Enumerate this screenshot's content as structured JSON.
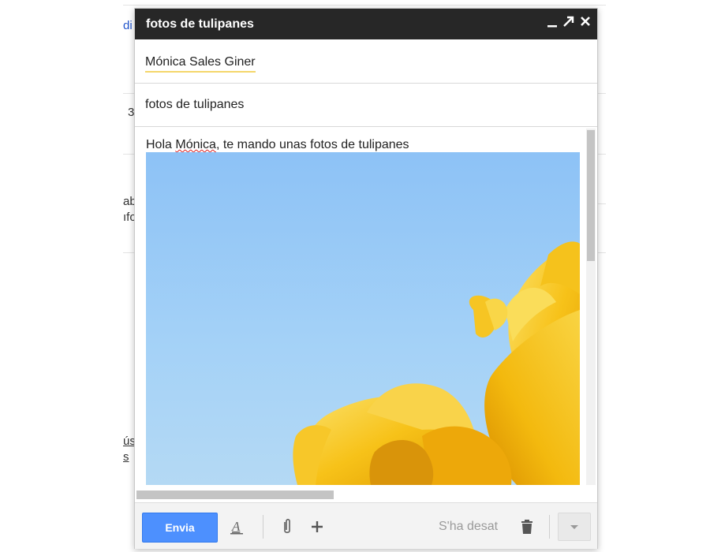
{
  "compose": {
    "title": "fotos de tulipanes",
    "to": "Mónica Sales Giner",
    "subject": "fotos de tulipanes",
    "body_greeting": "Hola ",
    "body_name": "Mónica",
    "body_rest": ", te mando unas fotos de tulipanes",
    "image_alt": "foto de tulipanes"
  },
  "toolbar": {
    "send_label": "Envia",
    "saved_status": "S'ha desat"
  },
  "background": {
    "fragment_1": "di",
    "fragment_2": "3",
    "fragment_3": "ab",
    "fragment_4": "ıfo",
    "fragment_5": "ús",
    "fragment_6": "s"
  },
  "icons": {
    "minimize": "minimize-icon",
    "popout": "popout-icon",
    "close": "close-icon",
    "formatting": "text-format-icon",
    "attach": "paperclip-icon",
    "insert": "plus-icon",
    "discard": "trash-icon",
    "more": "chevron-down-icon"
  },
  "colors": {
    "titlebar": "#272727",
    "send_button": "#4d90fe",
    "sky": "#9fd0f8",
    "tulip": "#f7c41a"
  }
}
